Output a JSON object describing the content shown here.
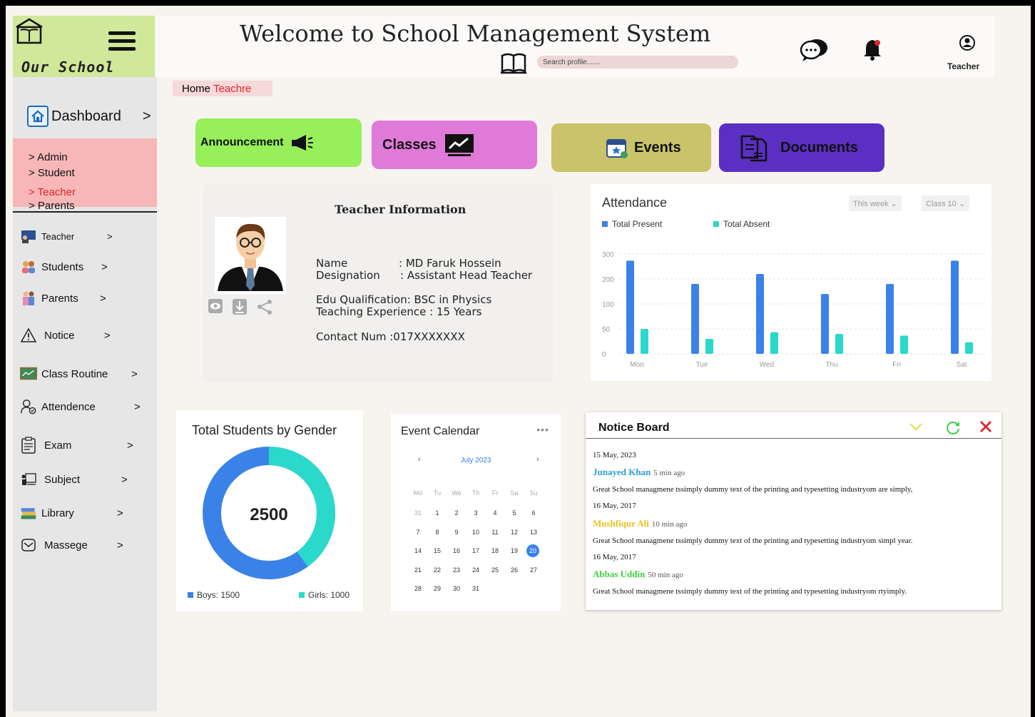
{
  "logo": {
    "name": "Our School"
  },
  "header": {
    "title": "Welcome to School Management System",
    "search_placeholder": "Search profile.......",
    "user_label": "Teacher"
  },
  "sidebar": {
    "dashboard": "Dashboard",
    "arrow": ">",
    "submenu": [
      "> Admin",
      "> Student",
      "> Teacher",
      "> Parents"
    ],
    "items": [
      {
        "label": "Teacher",
        "icon": "teacher-board-icon"
      },
      {
        "label": "Students",
        "icon": "students-icon"
      },
      {
        "label": "Parents",
        "icon": "parents-icon"
      },
      {
        "label": "Notice",
        "icon": "warning-icon"
      },
      {
        "label": "Class Routine",
        "icon": "chalkboard-icon"
      },
      {
        "label": "Attendence",
        "icon": "attendance-user-icon"
      },
      {
        "label": "Exam",
        "icon": "clipboard-icon"
      },
      {
        "label": "Subject",
        "icon": "subject-board-icon"
      },
      {
        "label": "Library",
        "icon": "books-icon"
      },
      {
        "label": "Massege",
        "icon": "message-icon"
      }
    ]
  },
  "breadcrumb": {
    "home": "Home",
    "current": "Teachre"
  },
  "tiles": {
    "announcement": "Announcement",
    "classes": "Classes",
    "events": "Events",
    "documents": "Documents"
  },
  "colors": {
    "announcement": "#97ef5a",
    "classes": "#e07ad9",
    "events": "#c9c36a",
    "documents": "#5a2fc2",
    "present": "#3b82e8",
    "absent": "#2ad9c9"
  },
  "teacher_info": {
    "title": "Teacher Information",
    "name_label": "Name",
    "name_value": ": MD Faruk Hossein",
    "designation_label": "Designation",
    "designation_value": ": Assistant Head Teacher",
    "qualification": "Edu Qualification:  BSC in Physics",
    "experience": "Teaching Experience : 15 Years",
    "contact": "Contact Num :017XXXXXXX"
  },
  "attendance": {
    "title": "Attendance",
    "filter_period": "This week",
    "filter_class": "Class 10",
    "legend_present": "Total Present",
    "legend_absent": "Total Absent"
  },
  "chart_data": {
    "type": "bar",
    "title": "Attendance",
    "categories": [
      "Mon",
      "Tue",
      "Wed",
      "Thu",
      "Fri",
      "Sat"
    ],
    "y_ticks": [
      "300",
      "200",
      "100",
      "50",
      "0"
    ],
    "series": [
      {
        "name": "Total Present",
        "values": [
          280,
          210,
          240,
          180,
          210,
          280
        ]
      },
      {
        "name": "Total Absent",
        "values": [
          75,
          45,
          65,
          60,
          55,
          35
        ]
      }
    ],
    "ylim": [
      0,
      300
    ],
    "grid": true,
    "legend": "top-left"
  },
  "gender": {
    "title": "Total Students by Gender",
    "total": "2500",
    "boys_label": "Boys: 1500",
    "girls_label": "Girls: 1000",
    "boys": 1500,
    "girls": 1000
  },
  "calendar": {
    "title": "Event Calendar",
    "dots": "•••",
    "month": "July 2023",
    "prev": "‹",
    "next": "›",
    "weekdays": [
      "Mo",
      "Tu",
      "We",
      "Th",
      "Fr",
      "Sa",
      "Su"
    ],
    "weeks": [
      [
        "31",
        "1",
        "2",
        "3",
        "4",
        "5",
        "6"
      ],
      [
        "7",
        "8",
        "9",
        "10",
        "11",
        "12",
        "13"
      ],
      [
        "14",
        "15",
        "16",
        "17",
        "18",
        "19",
        "20"
      ],
      [
        "21",
        "22",
        "23",
        "24",
        "25",
        "26",
        "27"
      ],
      [
        "28",
        "29",
        "30",
        "31",
        "",
        "",
        ""
      ]
    ],
    "selected": "20"
  },
  "notice_board": {
    "title": "Notice Board",
    "entries": [
      {
        "date": "15 May, 2023",
        "author": "Junayed Khan",
        "ago": "5 min ago",
        "color": "#2a9fd6",
        "text": "Great School managmene tssimply dummy text of the printing and typesetting industryom are simply,"
      },
      {
        "date": "16 May, 2017",
        "author": "Mushfiqur Ali",
        "ago": "10 min ago",
        "color": "#e6c21c",
        "text": "Great School managmene tssimply dummy text of the printing and typesetting industryom simpl year."
      },
      {
        "date": "16 May, 2017",
        "author": "Abbas Uddin",
        "ago": "50 min ago",
        "color": "#3fcf3f",
        "text": "Great School managmene tssimply dummy text of the printing and typesetting industryom rtyimply."
      }
    ]
  }
}
